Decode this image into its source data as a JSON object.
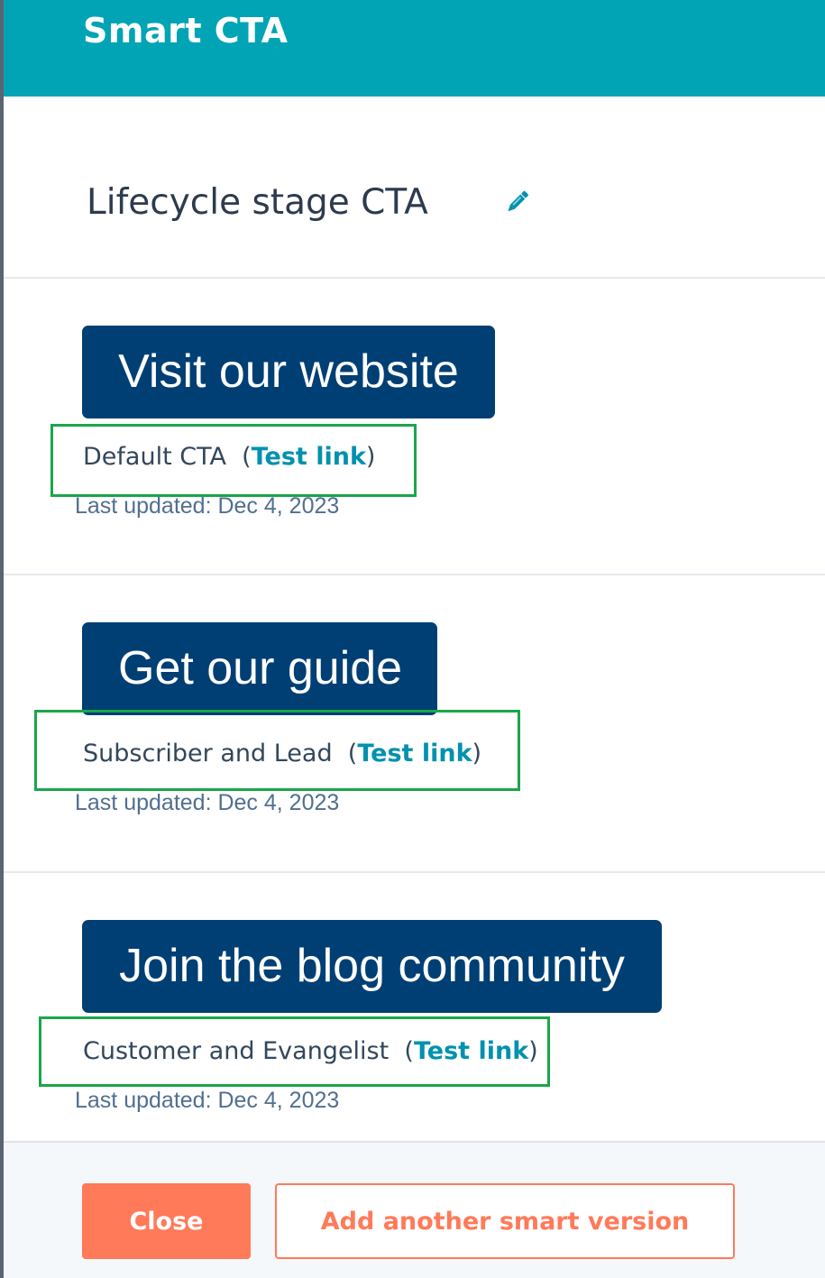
{
  "panel": {
    "title": "Smart CTA",
    "cta_name": "Lifecycle stage CTA"
  },
  "versions": [
    {
      "button_label": "Visit our website",
      "rule": "Default CTA",
      "test_link": "Test link",
      "last_updated": "Last updated: Dec 4, 2023"
    },
    {
      "button_label": "Get our guide",
      "rule": "Subscriber and Lead",
      "test_link": "Test link",
      "last_updated": "Last updated: Dec 4, 2023"
    },
    {
      "button_label": "Join the blog community",
      "rule": "Customer and Evangelist",
      "test_link": "Test link",
      "last_updated": "Last updated: Dec 4, 2023"
    }
  ],
  "footer": {
    "close_label": "Close",
    "add_label": "Add another smart version"
  },
  "colors": {
    "header": "#00a4b4",
    "cta_button": "#003f74",
    "link": "#0091ae",
    "accent": "#ff7a59",
    "highlight": "#1aa64a"
  },
  "icons": {
    "edit": "pencil-icon"
  }
}
